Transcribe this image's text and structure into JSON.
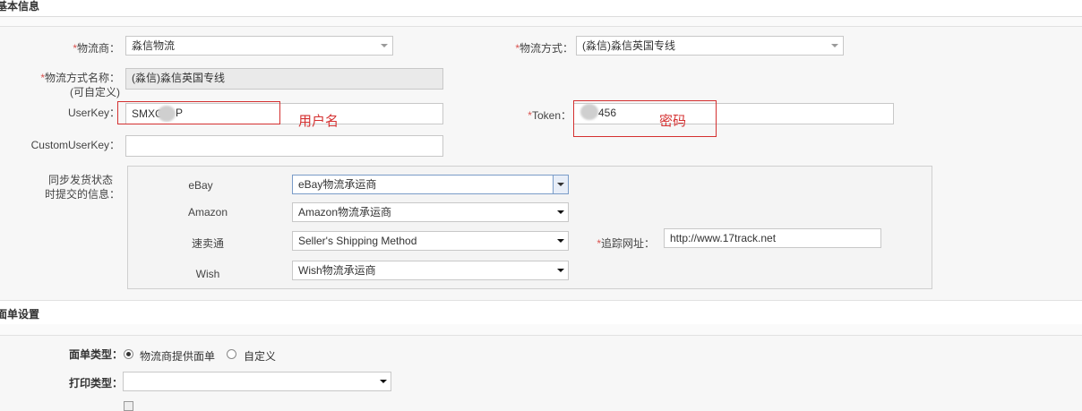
{
  "basic_section": {
    "title": "基本信息"
  },
  "carrier": {
    "label": "物流商：",
    "value": "淼信物流"
  },
  "shipping_method": {
    "label": "物流方式：",
    "value": "(淼信)淼信英国专线"
  },
  "method_name": {
    "label": "物流方式名称：",
    "sublabel": "(可自定义)",
    "value": "(淼信)淼信英国专线"
  },
  "userkey": {
    "label": "UserKey：",
    "value": "SMXC",
    "value_tail": "P",
    "annotation": "用户名"
  },
  "token": {
    "label": "Token：",
    "value_tail": "456",
    "annotation": "密码"
  },
  "custom_userkey": {
    "label": "CustomUserKey：",
    "value": ""
  },
  "sync": {
    "label_line1": "同步发货状态",
    "label_line2": "时提交的信息：",
    "rows": [
      {
        "platform": "eBay",
        "value": "eBay物流承运商"
      },
      {
        "platform": "Amazon",
        "value": "Amazon物流承运商"
      },
      {
        "platform": "速卖通",
        "value": "Seller's Shipping Method"
      },
      {
        "platform": "Wish",
        "value": "Wish物流承运商"
      }
    ],
    "tracking_label": "追踪网址：",
    "tracking_value": "http://www.17track.net"
  },
  "label_section": {
    "title": "面单设置"
  },
  "label_type": {
    "label": "面单类型：",
    "option1": "物流商提供面单",
    "option2": "自定义"
  },
  "print_type": {
    "label": "打印类型：",
    "value": ""
  },
  "colors": {
    "required": "#d9534f",
    "annotation": "#d43030",
    "focus_border": "#7a9cc8"
  }
}
